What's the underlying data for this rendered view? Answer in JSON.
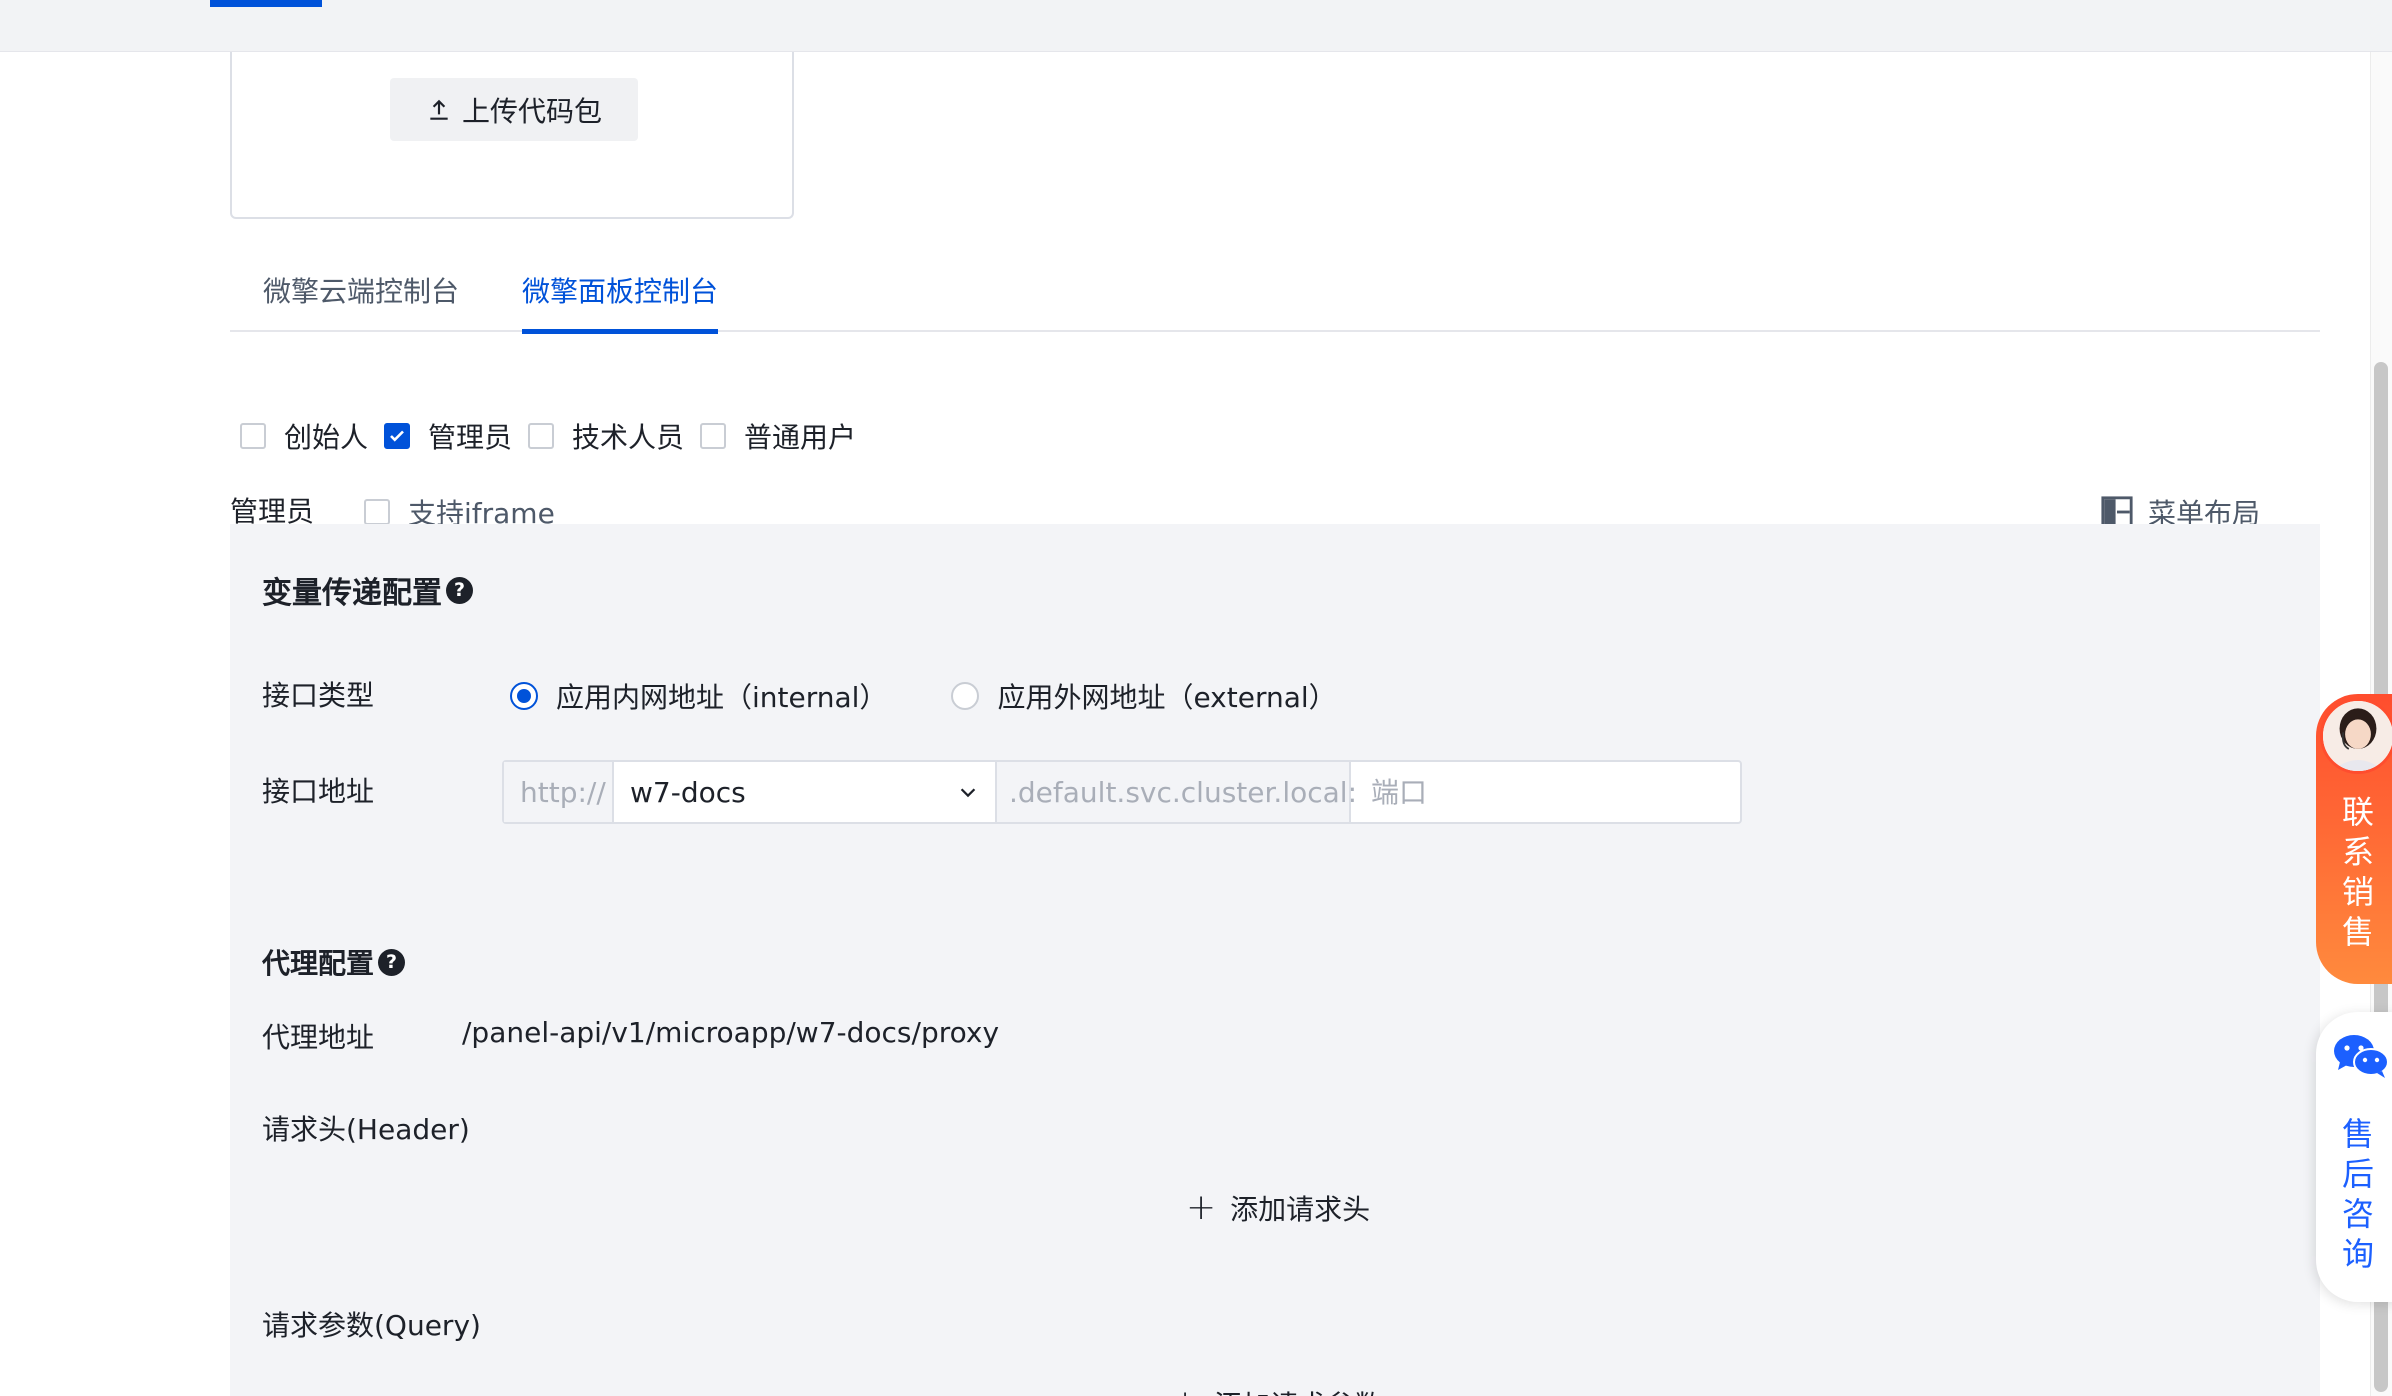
{
  "upload": {
    "button_label": "上传代码包",
    "icon": "upload-icon"
  },
  "tabs": [
    {
      "label": "微擎云端控制台",
      "active": false
    },
    {
      "label": "微擎面板控制台",
      "active": true
    }
  ],
  "roles": [
    {
      "label": "创始人",
      "checked": false
    },
    {
      "label": "管理员",
      "checked": true
    },
    {
      "label": "技术人员",
      "checked": false
    },
    {
      "label": "普通用户",
      "checked": false
    }
  ],
  "role_row": {
    "label": "管理员",
    "iframe_label": "支持iframe",
    "iframe_checked": false,
    "menu_layout_label": "菜单布局",
    "menu_layout_icon": "layout-icon"
  },
  "var_config": {
    "title": "变量传递配置",
    "interface_type_label": "接口类型",
    "interface_types": [
      {
        "label": "应用内网地址（internal）",
        "selected": true
      },
      {
        "label": "应用外网地址（external）",
        "selected": false
      }
    ],
    "interface_addr_label": "接口地址",
    "addr_prefix": "http://",
    "addr_service": "w7-docs",
    "addr_suffix": ".default.svc.cluster.local:",
    "port_placeholder": "端口"
  },
  "proxy_config": {
    "title": "代理配置",
    "proxy_addr_label": "代理地址",
    "proxy_addr_value": "/panel-api/v1/microapp/w7-docs/proxy",
    "header_label": "请求头(Header)",
    "add_header_label": "添加请求头",
    "query_label": "请求参数(Query)",
    "add_query_label": "添加请求参数"
  },
  "floating": {
    "sales_label": "联\n系\n销\n售",
    "support_label": "售\n后\n咨\n询"
  },
  "colors": {
    "primary": "#0052d9",
    "sales_gradient_top": "#ff4d2e",
    "support_text": "#1c60ff",
    "panel_bg": "#f3f4f7"
  }
}
